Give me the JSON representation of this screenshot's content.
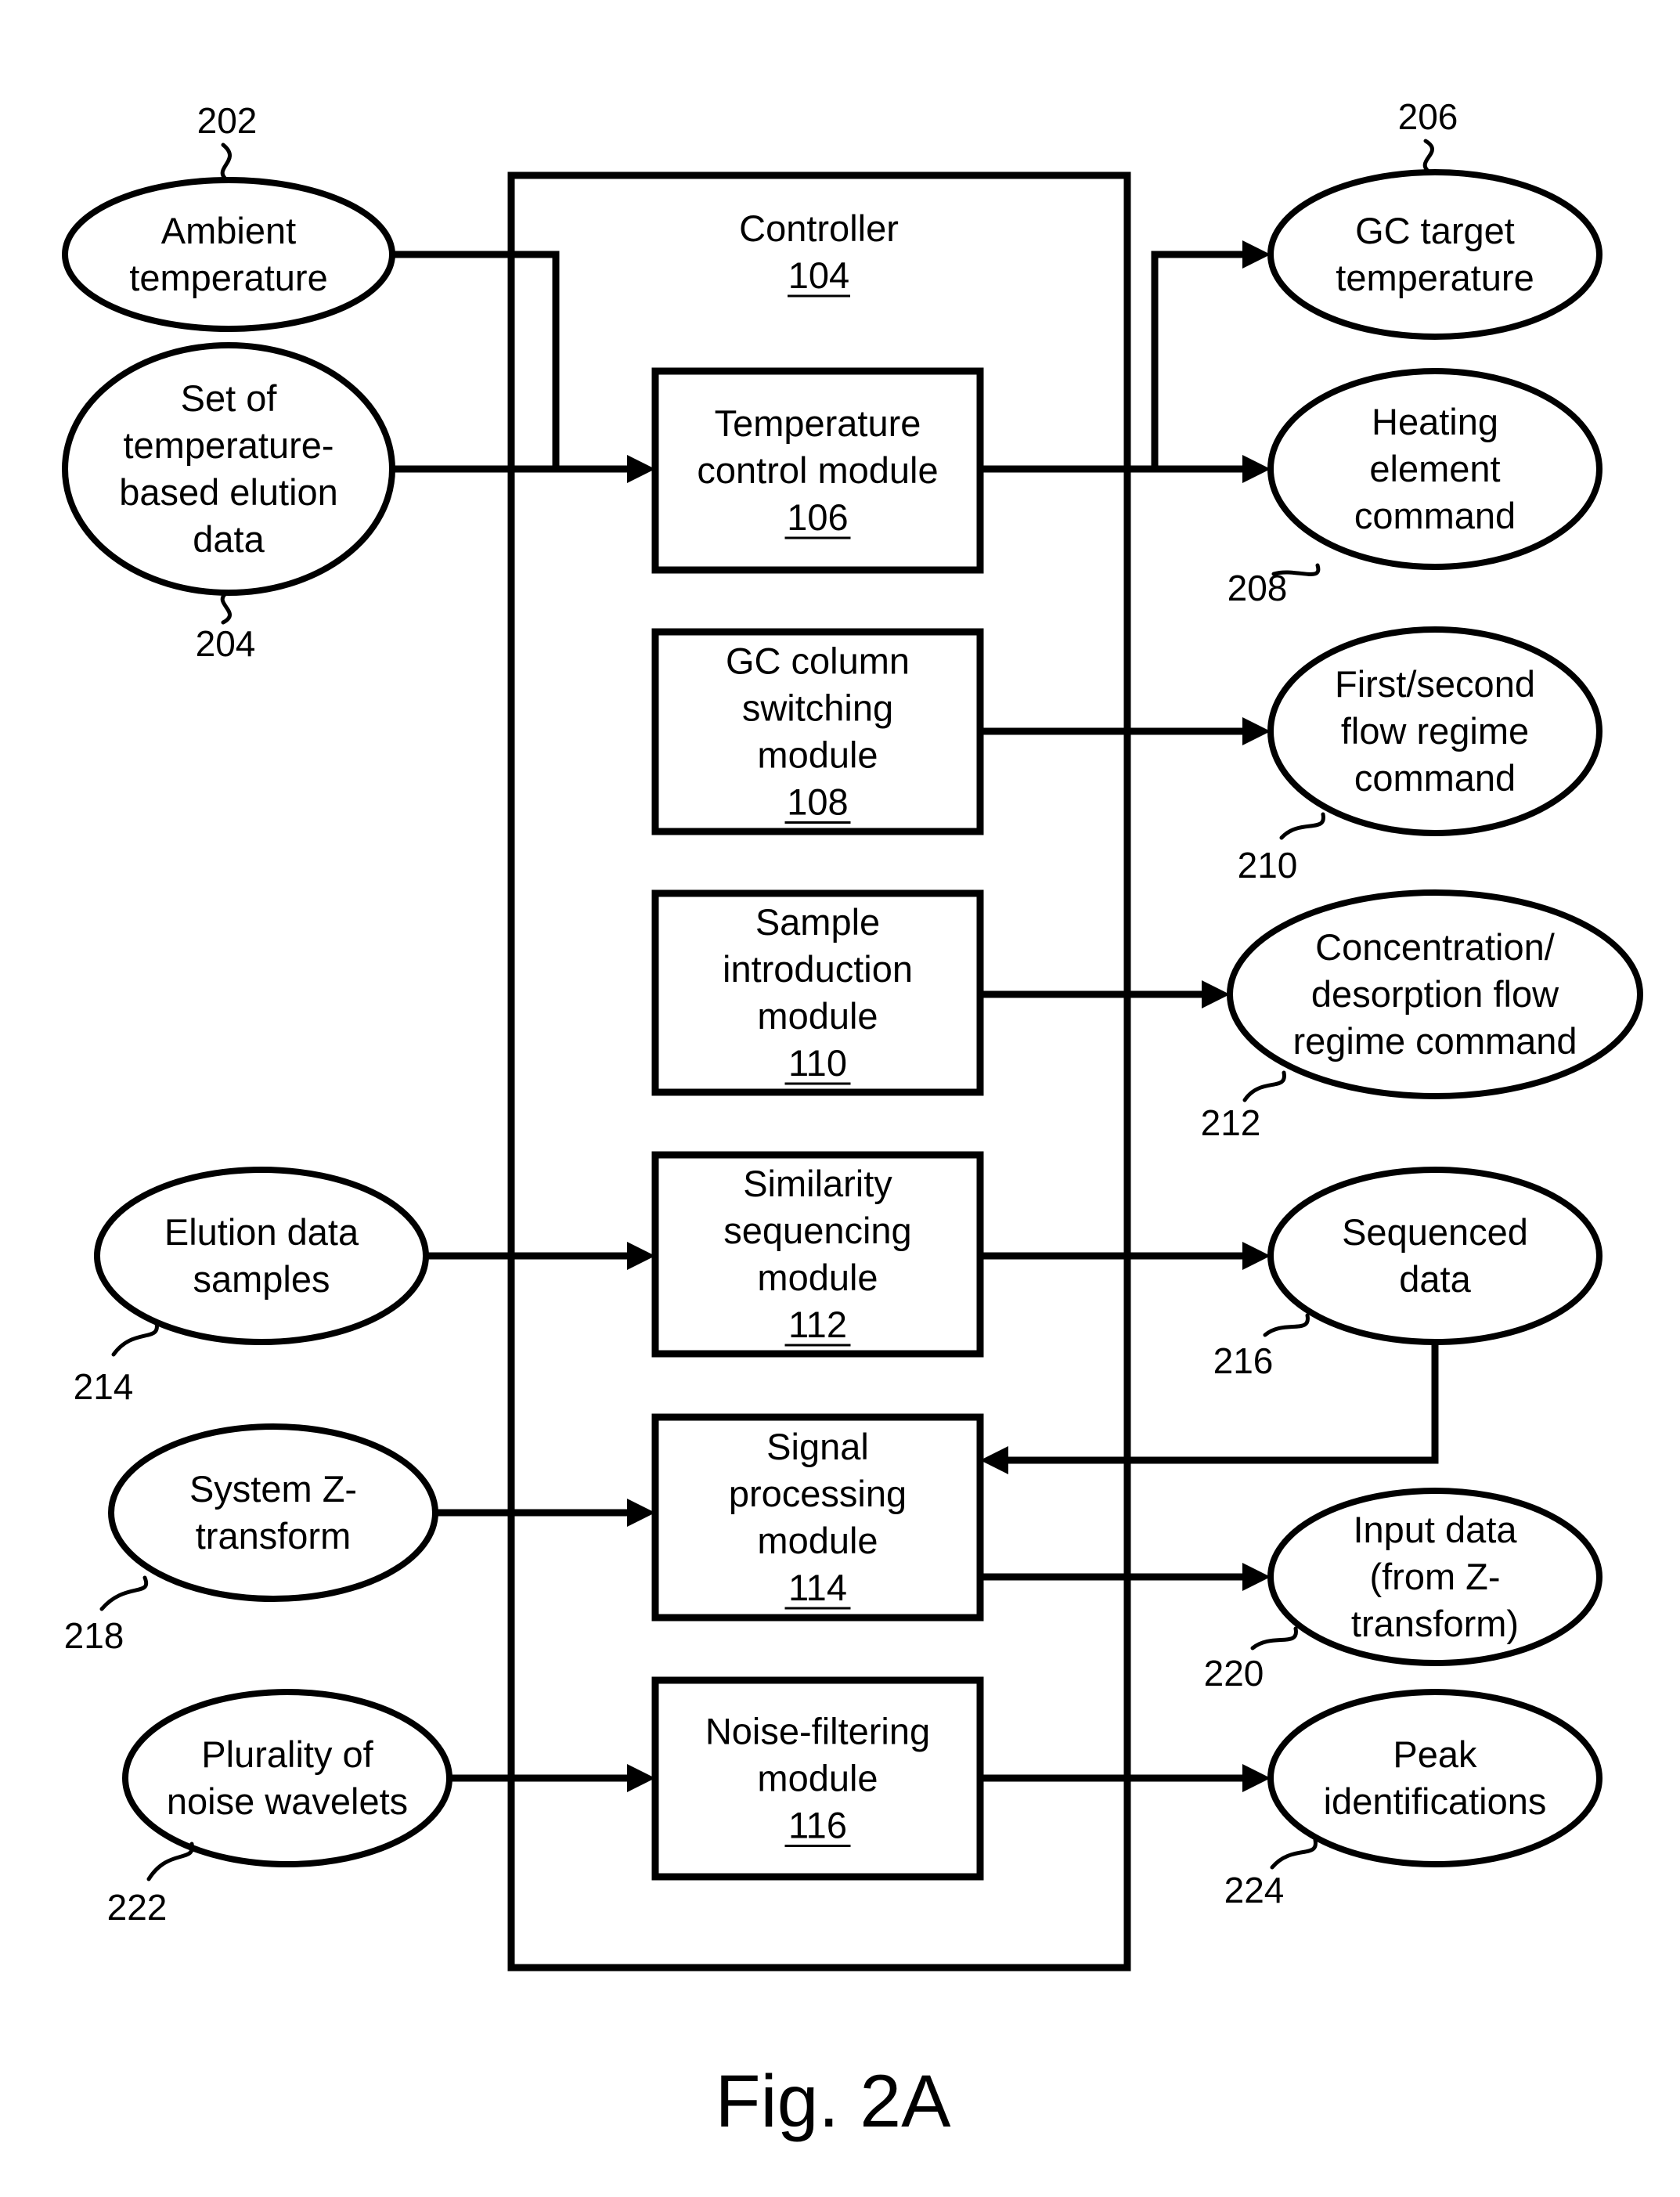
{
  "figure_caption": "Fig. 2A",
  "controller": {
    "title": "Controller",
    "ref": "104"
  },
  "modules": [
    {
      "id": "temperature-control",
      "lines": [
        "Temperature",
        "control module"
      ],
      "ref": "106"
    },
    {
      "id": "gc-column-switching",
      "lines": [
        "GC column",
        "switching",
        "module"
      ],
      "ref": "108"
    },
    {
      "id": "sample-introduction",
      "lines": [
        "Sample",
        "introduction",
        "module"
      ],
      "ref": "110"
    },
    {
      "id": "similarity-sequencing",
      "lines": [
        "Similarity",
        "sequencing",
        "module"
      ],
      "ref": "112"
    },
    {
      "id": "signal-processing",
      "lines": [
        "Signal",
        "processing",
        "module"
      ],
      "ref": "114"
    },
    {
      "id": "noise-filtering",
      "lines": [
        "Noise-filtering",
        "module"
      ],
      "ref": "116"
    }
  ],
  "inputs": [
    {
      "id": "ambient-temperature",
      "lines": [
        "Ambient",
        "temperature"
      ],
      "ref": "202"
    },
    {
      "id": "temperature-based-elution-data",
      "lines": [
        "Set of",
        "temperature-",
        "based elution",
        "data"
      ],
      "ref": "204"
    },
    {
      "id": "elution-data-samples",
      "lines": [
        "Elution data",
        "samples"
      ],
      "ref": "214"
    },
    {
      "id": "system-z-transform",
      "lines": [
        "System Z-",
        "transform"
      ],
      "ref": "218"
    },
    {
      "id": "noise-wavelets",
      "lines": [
        "Plurality of",
        "noise wavelets"
      ],
      "ref": "222"
    }
  ],
  "outputs": [
    {
      "id": "gc-target-temperature",
      "lines": [
        "GC target",
        "temperature"
      ],
      "ref": "206"
    },
    {
      "id": "heating-element-command",
      "lines": [
        "Heating",
        "element",
        "command"
      ],
      "ref": "208"
    },
    {
      "id": "flow-regime-command",
      "lines": [
        "First/second",
        "flow regime",
        "command"
      ],
      "ref": "210"
    },
    {
      "id": "concentration-desorption-command",
      "lines": [
        "Concentration/",
        "desorption flow",
        "regime command"
      ],
      "ref": "212"
    },
    {
      "id": "sequenced-data",
      "lines": [
        "Sequenced",
        "data"
      ],
      "ref": "216"
    },
    {
      "id": "input-data-from-z-transform",
      "lines": [
        "Input data",
        "(from Z-",
        "transform)"
      ],
      "ref": "220"
    },
    {
      "id": "peak-identifications",
      "lines": [
        "Peak",
        "identifications"
      ],
      "ref": "224"
    }
  ],
  "connections": [
    {
      "from": "ambient-temperature",
      "to": "temperature-control"
    },
    {
      "from": "temperature-based-elution-data",
      "to": "temperature-control"
    },
    {
      "from": "temperature-control",
      "to": "gc-target-temperature"
    },
    {
      "from": "temperature-control",
      "to": "heating-element-command"
    },
    {
      "from": "gc-column-switching",
      "to": "flow-regime-command"
    },
    {
      "from": "sample-introduction",
      "to": "concentration-desorption-command"
    },
    {
      "from": "elution-data-samples",
      "to": "similarity-sequencing"
    },
    {
      "from": "similarity-sequencing",
      "to": "sequenced-data"
    },
    {
      "from": "sequenced-data",
      "to": "signal-processing"
    },
    {
      "from": "system-z-transform",
      "to": "signal-processing"
    },
    {
      "from": "signal-processing",
      "to": "input-data-from-z-transform"
    },
    {
      "from": "noise-wavelets",
      "to": "noise-filtering"
    },
    {
      "from": "noise-filtering",
      "to": "peak-identifications"
    }
  ]
}
